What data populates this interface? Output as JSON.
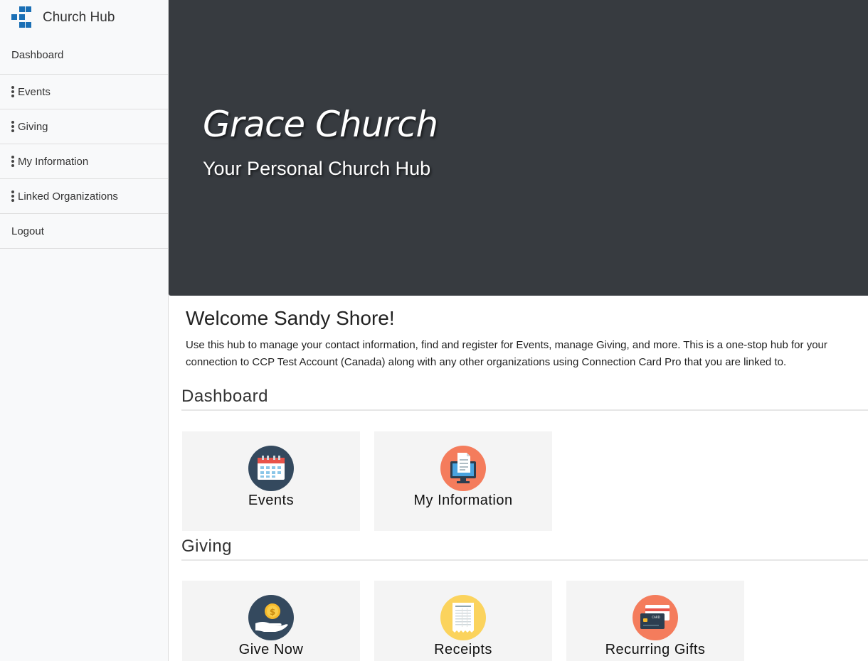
{
  "brand": {
    "title": "Church Hub",
    "logo_color": "#1a6fb5"
  },
  "sidebar": {
    "items": [
      {
        "label": "Dashboard",
        "has_menu": false
      },
      {
        "label": "Events",
        "has_menu": true
      },
      {
        "label": "Giving",
        "has_menu": true
      },
      {
        "label": "My Information",
        "has_menu": true
      },
      {
        "label": "Linked Organizations",
        "has_menu": true
      },
      {
        "label": "Logout",
        "has_menu": false
      }
    ]
  },
  "hero": {
    "title": "Grace Church",
    "subtitle": "Your Personal Church Hub",
    "background": "#373b40"
  },
  "welcome": {
    "heading": "Welcome Sandy Shore!",
    "text": "Use this hub to manage your contact information, find and register for Events, manage Giving, and more. This is a one-stop hub for your connection to CCP Test Account (Canada) along with any other organizations using Connection Card Pro that you are linked to."
  },
  "sections": {
    "dashboard": {
      "title": "Dashboard",
      "tiles": [
        {
          "label": "Events",
          "icon": "calendar-icon",
          "icon_bg": "#34495e"
        },
        {
          "label": "My Information",
          "icon": "monitor-document-icon",
          "icon_bg": "#f47c5c"
        }
      ]
    },
    "giving": {
      "title": "Giving",
      "tiles": [
        {
          "label": "Give Now",
          "icon": "coin-hand-icon",
          "icon_bg": "#34495e"
        },
        {
          "label": "Receipts",
          "icon": "receipt-icon",
          "icon_bg": "#fbd35d"
        },
        {
          "label": "Recurring Gifts",
          "icon": "credit-card-icon",
          "icon_bg": "#f47c5c"
        }
      ]
    }
  }
}
